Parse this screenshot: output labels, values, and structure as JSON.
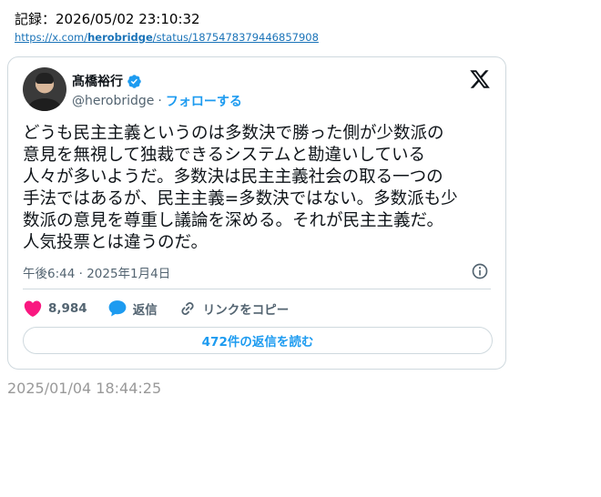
{
  "header": {
    "record": "記録：2026/05/02 23:10:32",
    "url_prefix": "https://x.com/",
    "url_user": "herobridge",
    "url_suffix": "/status/1875478379446857908"
  },
  "tweet": {
    "display_name": "髙橋裕行",
    "handle": "@herobridge",
    "separator": "·",
    "follow_label": "フォローする",
    "text": "どうも民主主義というのは多数決で勝った側が少数派の\n意見を無視して独裁できるシステムと勘違いしている\n人々が多いようだ。多数決は民主主義社会の取る一つの\n手法ではあるが、民主主義=多数決ではない。多数派も少\n数派の意見を尊重し議論を深める。それが民主主義だ。\n人気投票とは違うのだ。",
    "timestamp": "午後6:44 · 2025年1月4日",
    "like_count": "8,984",
    "reply_label": "返信",
    "copy_link_label": "リンクをコピー",
    "read_replies_label": "472件の返信を読む"
  },
  "footer": {
    "capture_time": "2025/01/04 18:44:25"
  },
  "icons": {
    "verified": "verified-badge-icon",
    "x_logo": "x-logo-icon",
    "info": "info-icon",
    "like": "heart-icon",
    "reply": "speech-bubble-icon",
    "link": "link-icon"
  },
  "colors": {
    "accent": "#1d9bf0",
    "like": "#f91880",
    "muted": "#536471",
    "border": "#cfd9de"
  }
}
